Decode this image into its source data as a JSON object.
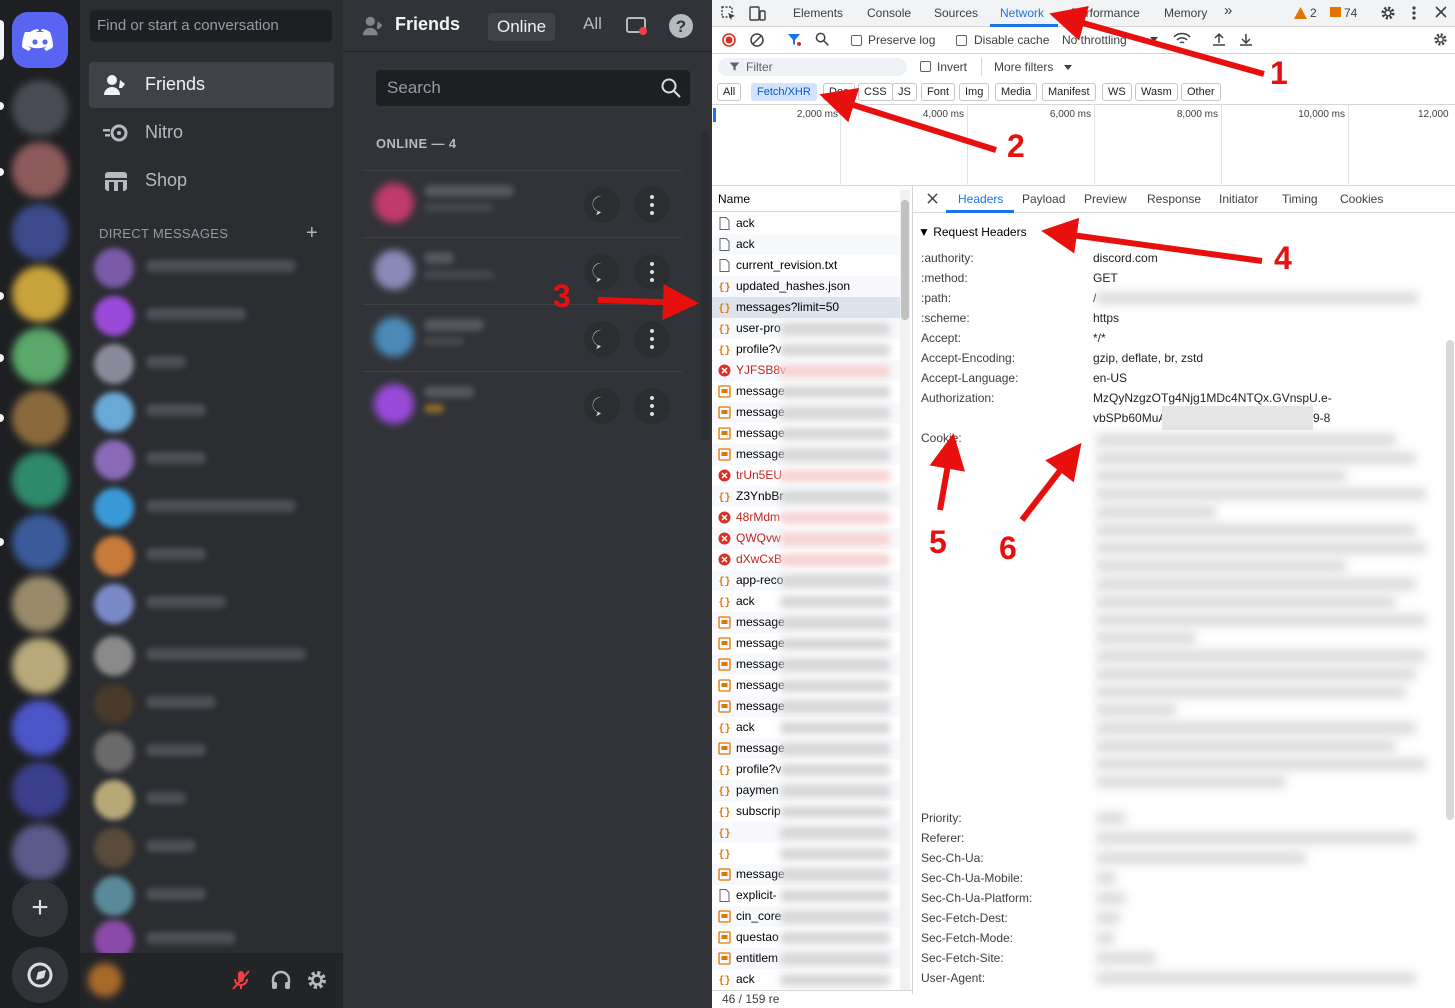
{
  "discord": {
    "search_placeholder": "Find or start a conversation",
    "nav": [
      {
        "label": "Friends",
        "icon": "friends-icon"
      },
      {
        "label": "Nitro",
        "icon": "nitro-icon"
      },
      {
        "label": "Shop",
        "icon": "shop-icon"
      }
    ],
    "dm_header": "DIRECT MESSAGES",
    "dm_add": "+",
    "header": {
      "title": "Friends",
      "tab_online": "Online",
      "tab_all": "All"
    },
    "friends_search_placeholder": "Search",
    "online_header": "ONLINE — 4",
    "colors": {
      "rail": "#1e1f22",
      "sidebar": "#2b2d31",
      "main": "#313338",
      "brand": "#5865f2"
    }
  },
  "devtools": {
    "tabs": [
      "Elements",
      "Console",
      "Sources",
      "Network",
      "Performance",
      "Memory"
    ],
    "active_tab": "Network",
    "more_tabs": "»",
    "warnings": "2",
    "issues": "74",
    "toolbar": {
      "preserve_log": "Preserve log",
      "disable_cache": "Disable cache",
      "throttling": "No throttling"
    },
    "filter": {
      "placeholder": "Filter",
      "invert": "Invert",
      "more_filters": "More filters"
    },
    "type_filters": [
      "All",
      "Fetch/XHR",
      "Doc",
      "CSS",
      "JS",
      "Font",
      "Img",
      "Media",
      "Manifest",
      "WS",
      "Wasm",
      "Other"
    ],
    "active_type": "Fetch/XHR",
    "timeline_labels": [
      "2,000 ms",
      "4,000 ms",
      "6,000 ms",
      "8,000 ms",
      "10,000 ms",
      "12,000"
    ],
    "name_header": "Name",
    "requests": [
      {
        "name": "ack",
        "type": "doc"
      },
      {
        "name": "ack",
        "type": "doc"
      },
      {
        "name": "current_revision.txt",
        "type": "doc"
      },
      {
        "name": "updated_hashes.json",
        "type": "xhr"
      },
      {
        "name": "messages?limit=50",
        "type": "xhr",
        "selected": true
      },
      {
        "name": "user-pro",
        "type": "xhr"
      },
      {
        "name": "profile?v",
        "type": "xhr"
      },
      {
        "name": "YJFSB8v",
        "type": "err"
      },
      {
        "name": "message",
        "type": "img"
      },
      {
        "name": "message",
        "type": "img"
      },
      {
        "name": "message",
        "type": "img"
      },
      {
        "name": "message",
        "type": "img"
      },
      {
        "name": "trUn5EU",
        "type": "err"
      },
      {
        "name": "Z3YnbBr",
        "type": "xhr"
      },
      {
        "name": "48rMdm",
        "type": "err"
      },
      {
        "name": "QWQvw",
        "type": "err"
      },
      {
        "name": "dXwCxB",
        "type": "err"
      },
      {
        "name": "app-reco",
        "type": "xhr"
      },
      {
        "name": "ack",
        "type": "xhr"
      },
      {
        "name": "message",
        "type": "img"
      },
      {
        "name": "message",
        "type": "img"
      },
      {
        "name": "message",
        "type": "img"
      },
      {
        "name": "message",
        "type": "img"
      },
      {
        "name": "message",
        "type": "img"
      },
      {
        "name": "ack",
        "type": "xhr"
      },
      {
        "name": "message",
        "type": "img"
      },
      {
        "name": "profile?v",
        "type": "xhr"
      },
      {
        "name": "paymen",
        "type": "xhr"
      },
      {
        "name": "subscrip",
        "type": "xhr"
      },
      {
        "name": "",
        "type": "xhr"
      },
      {
        "name": "",
        "type": "xhr"
      },
      {
        "name": "message",
        "type": "img"
      },
      {
        "name": "explicit-",
        "type": "doc"
      },
      {
        "name": "cin_core",
        "type": "img"
      },
      {
        "name": "questao",
        "type": "img"
      },
      {
        "name": "entitlem",
        "type": "img"
      },
      {
        "name": "ack",
        "type": "xhr"
      }
    ],
    "status": "46 / 159 re",
    "detail_tabs": [
      "Headers",
      "Payload",
      "Preview",
      "Response",
      "Initiator",
      "Timing",
      "Cookies"
    ],
    "active_detail_tab": "Headers",
    "request_headers_title": "▼ Request Headers",
    "headers_top": [
      {
        "key": ":authority:",
        "value": "discord.com"
      },
      {
        "key": ":method:",
        "value": "GET"
      },
      {
        "key": ":path:",
        "value": "/"
      },
      {
        "key": ":scheme:",
        "value": "https"
      },
      {
        "key": "Accept:",
        "value": "*/*"
      },
      {
        "key": "Accept-Encoding:",
        "value": "gzip, deflate, br, zstd"
      },
      {
        "key": "Accept-Language:",
        "value": "en-US"
      },
      {
        "key": "Authorization:",
        "value": "MzQyNzgzOTg4Njg1MDc4NTQx.GVnspU.e-"
      }
    ],
    "auth_line2_start": "vbSPb60MuA",
    "auth_line2_end": "9-8",
    "cookie_key": "Cookie:",
    "headers_bottom": [
      "Priority:",
      "Referer:",
      "Sec-Ch-Ua:",
      "Sec-Ch-Ua-Mobile:",
      "Sec-Ch-Ua-Platform:",
      "Sec-Fetch-Dest:",
      "Sec-Fetch-Mode:",
      "Sec-Fetch-Site:",
      "User-Agent:"
    ]
  },
  "annotations": [
    "1",
    "2",
    "3",
    "4",
    "5",
    "6"
  ],
  "annotation_color": "#e8100f"
}
